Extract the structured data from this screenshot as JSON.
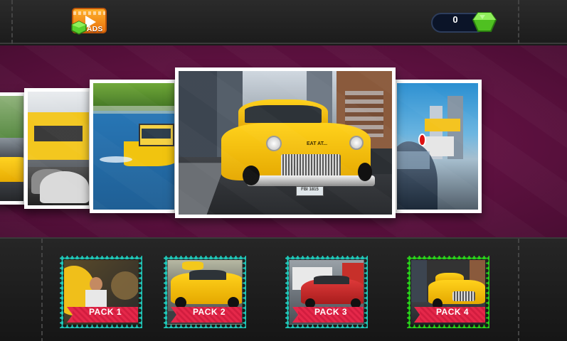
{
  "header": {
    "ads_button": {
      "label": "ADS",
      "icon": "video-ads-icon"
    },
    "gem_counter": {
      "value": "0",
      "icon": "green-gem-icon"
    }
  },
  "carousel": {
    "photos": [
      {
        "name": "taxi-street-far-left",
        "description_icon": "photo"
      },
      {
        "name": "yellow-bus-street",
        "description_icon": "photo"
      },
      {
        "name": "water-taxi-boat",
        "description_icon": "photo"
      },
      {
        "name": "yellow-checker-cab",
        "description_icon": "photo"
      },
      {
        "name": "city-street-traffic",
        "description_icon": "photo"
      }
    ],
    "center_plate": "EAT AT...",
    "license_plate": "FBI 1815"
  },
  "packs": [
    {
      "label": "PACK 1",
      "frame_color": "#1fc7b8",
      "selected": false
    },
    {
      "label": "PACK 2",
      "frame_color": "#1fc7b8",
      "selected": false
    },
    {
      "label": "PACK 3",
      "frame_color": "#1fc7b8",
      "selected": false
    },
    {
      "label": "PACK 4",
      "frame_color": "#29d21a",
      "selected": true
    }
  ],
  "colors": {
    "background_band": "#5e1140",
    "pack_label": "#e5284a",
    "taxi_yellow": "#ffd21c"
  }
}
